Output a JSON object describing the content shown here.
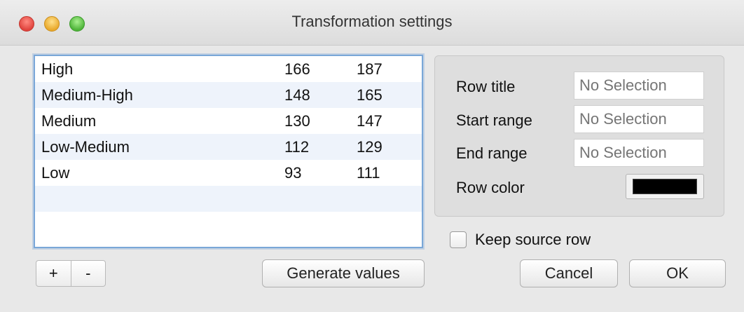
{
  "window": {
    "title": "Transformation settings"
  },
  "table": {
    "rows": [
      {
        "title": "High",
        "start": "166",
        "end": "187"
      },
      {
        "title": "Medium-High",
        "start": "148",
        "end": "165"
      },
      {
        "title": "Medium",
        "start": "130",
        "end": "147"
      },
      {
        "title": "Low-Medium",
        "start": "112",
        "end": "129"
      },
      {
        "title": "Low",
        "start": "93",
        "end": "111"
      },
      {
        "title": "",
        "start": "",
        "end": ""
      },
      {
        "title": "",
        "start": "",
        "end": ""
      }
    ]
  },
  "controls": {
    "add_label": "+",
    "remove_label": "-",
    "generate_label": "Generate values"
  },
  "details": {
    "row_title_label": "Row title",
    "row_title_placeholder": "No Selection",
    "start_range_label": "Start range",
    "start_range_placeholder": "No Selection",
    "end_range_label": "End range",
    "end_range_placeholder": "No Selection",
    "row_color_label": "Row color",
    "row_color_value": "#000000"
  },
  "options": {
    "keep_source_row_label": "Keep source row"
  },
  "footer": {
    "cancel_label": "Cancel",
    "ok_label": "OK"
  }
}
